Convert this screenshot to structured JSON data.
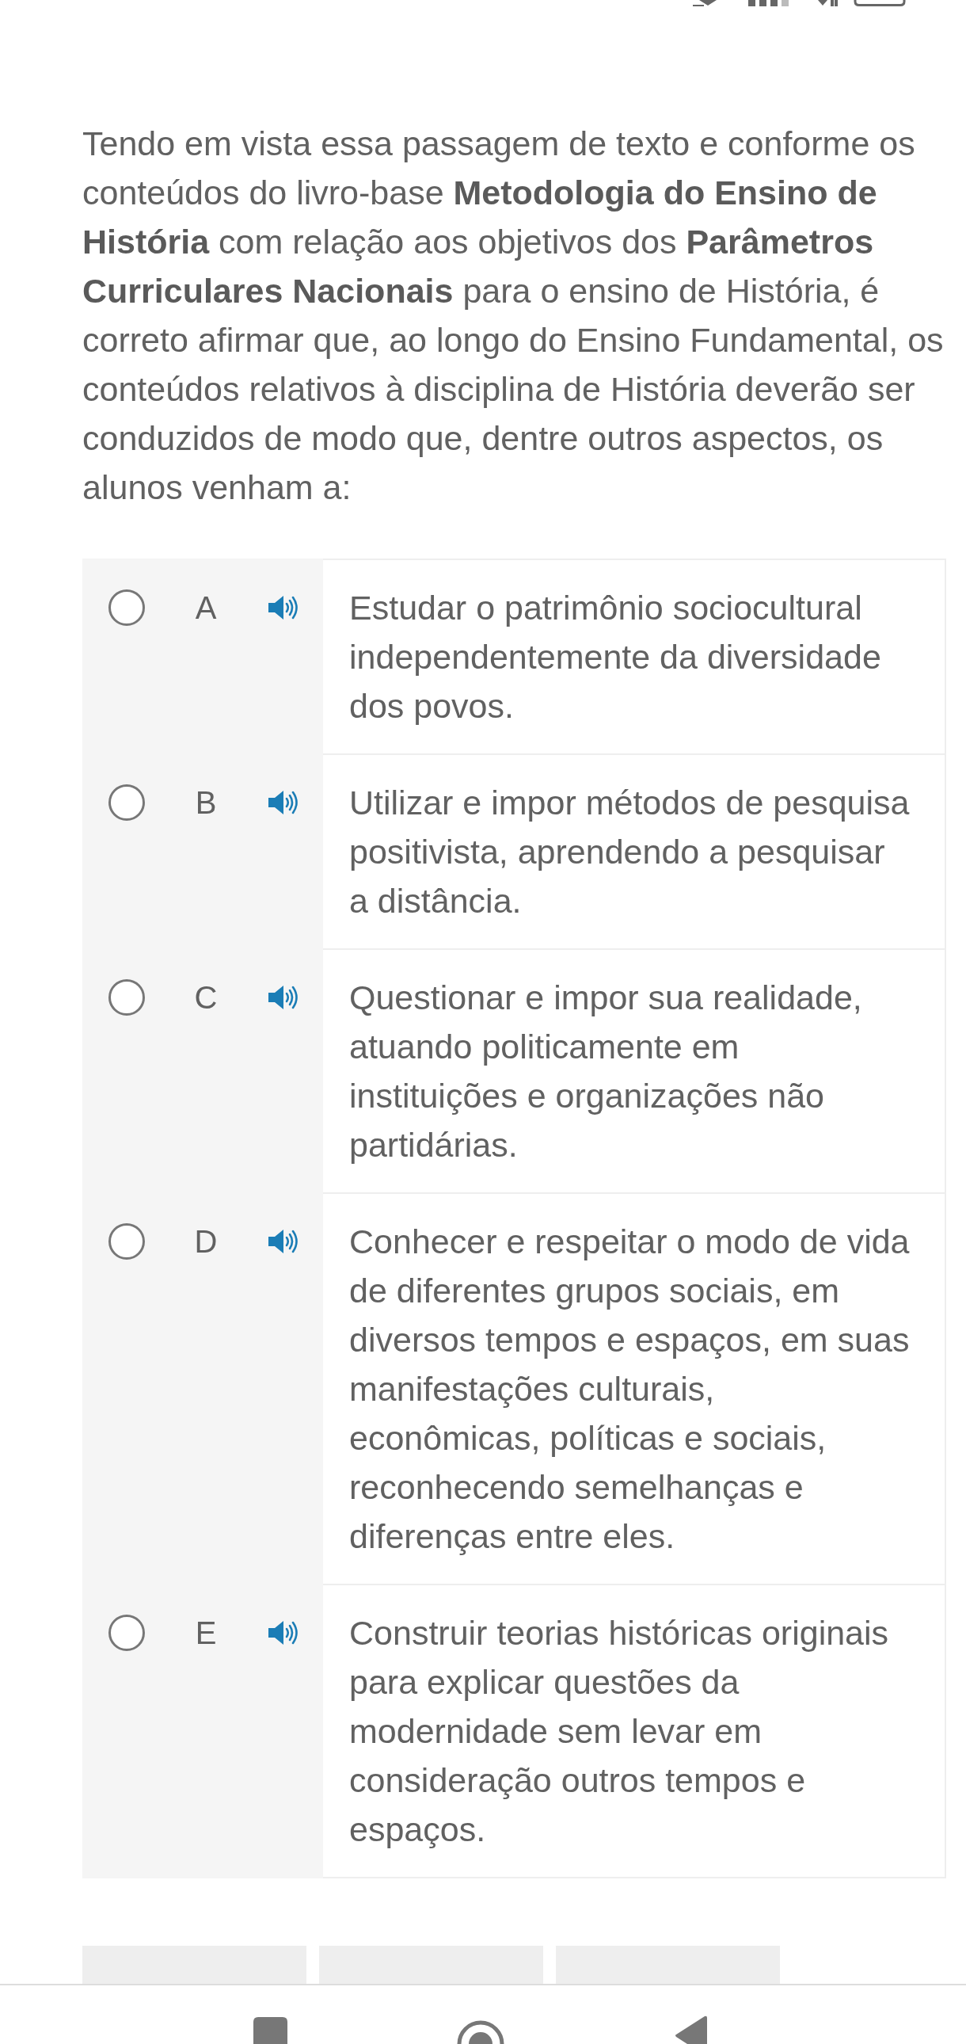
{
  "question": {
    "text": "Tendo em vista essa passagem de texto e conforme os conteúdos do livro-base **Metodologia do Ensino de História** com relação aos objetivos dos **Parâmetros Curriculares Nacionais** para o ensino de História, é correto afirmar que, ao longo do Ensino Fundamental, os conteúdos relativos à disciplina de História deverão ser conduzidos de modo que, dentre outros aspectos, os alunos venham a:"
  },
  "options": [
    {
      "letter": "A",
      "text": "Estudar o patrimônio sociocultural independentemente da diversidade dos povos.",
      "selected": false
    },
    {
      "letter": "B",
      "text": "Utilizar e impor métodos de pesquisa positivista, aprendendo a pesquisar a distância.",
      "selected": false
    },
    {
      "letter": "C",
      "text": "Questionar e impor sua realidade, atuando politicamente em instituições e organizações não partidárias.",
      "selected": false
    },
    {
      "letter": "D",
      "text": "Conhecer e respeitar o modo de vida de diferentes grupos sociais, em diversos tempos e espaços, em suas manifestações culturais, econômicas, políticas e sociais, reconhecendo semelhanças e diferenças entre eles.",
      "selected": false
    },
    {
      "letter": "E",
      "text": "Construir teorias históricas originais para explicar questões da modernidade sem levar em consideração outros tempos e espaços.",
      "selected": false
    }
  ],
  "pagination": [
    {
      "selected": false
    },
    {
      "selected": false
    },
    {
      "selected": false
    }
  ]
}
